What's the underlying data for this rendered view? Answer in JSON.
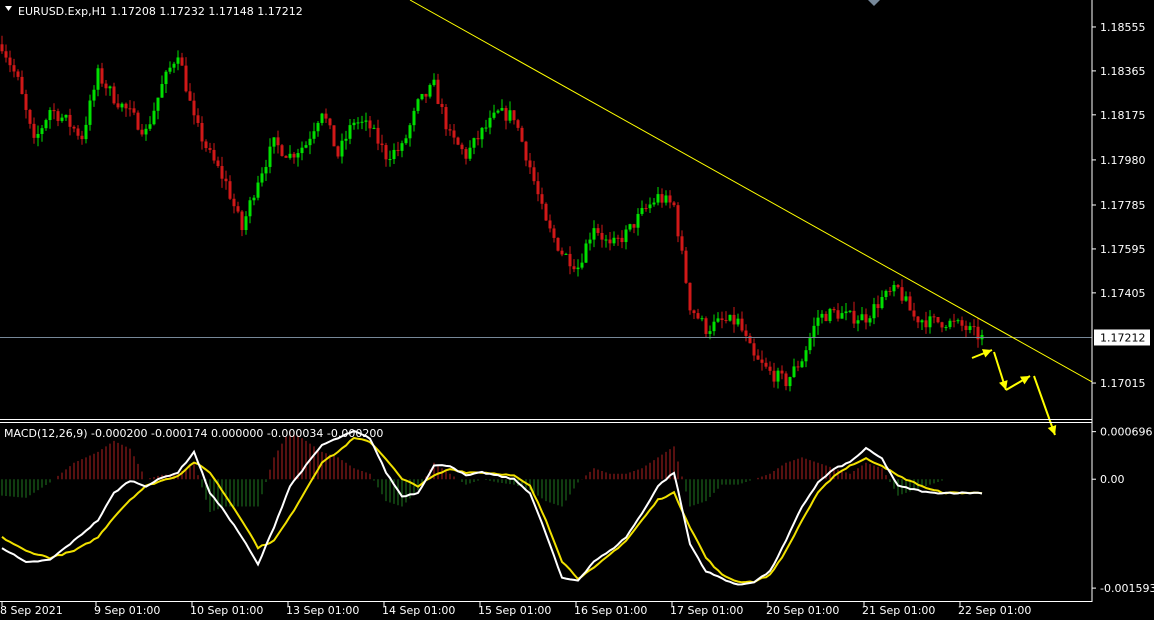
{
  "colors": {
    "background": "#000000",
    "axis": "#ffffff",
    "bull_candle": "#00e000",
    "bear_candle": "#d01818",
    "trendline": "#ffff00",
    "price_line": "#778899",
    "histogram_positive": "#b02020",
    "histogram_negative": "#1f7a1f",
    "macd_line": "#ffffff",
    "signal_line": "#f0e000",
    "arrows": "#ffff00"
  },
  "header": {
    "triangle_icon": "dropdown-triangle-icon",
    "symbol_text": "EURUSD.Exp,H1  1.17208 1.17232 1.17148 1.17212"
  },
  "macd_header": {
    "text": "MACD(12,26,9) -0.000200 -0.000174 0.000000 -0.000034 -0.000200"
  },
  "chart_data": [
    {
      "type": "candlestick",
      "title": "EURUSD.Exp,H1",
      "ylim": [
        1.1692,
        1.1865
      ],
      "y_ticks": [
        "1.18555",
        "1.18365",
        "1.18175",
        "1.17980",
        "1.17785",
        "1.17595",
        "1.17405",
        "1.17015"
      ],
      "current_price": "1.17212",
      "x_ticks": [
        "8 Sep 2021",
        "9 Sep 01:00",
        "10 Sep 01:00",
        "13 Sep 01:00",
        "14 Sep 01:00",
        "15 Sep 01:00",
        "16 Sep 01:00",
        "17 Sep 01:00",
        "20 Sep 01:00",
        "21 Sep 01:00",
        "22 Sep 01:00"
      ],
      "price_path_keypoints": [
        [
          0,
          1.1848
        ],
        [
          4,
          1.1832
        ],
        [
          8,
          1.1805
        ],
        [
          12,
          1.182
        ],
        [
          16,
          1.1815
        ],
        [
          20,
          1.1808
        ],
        [
          24,
          1.1835
        ],
        [
          28,
          1.1825
        ],
        [
          32,
          1.1818
        ],
        [
          36,
          1.181
        ],
        [
          40,
          1.183
        ],
        [
          44,
          1.1845
        ],
        [
          48,
          1.1815
        ],
        [
          52,
          1.18
        ],
        [
          56,
          1.1788
        ],
        [
          60,
          1.1768
        ],
        [
          64,
          1.179
        ],
        [
          68,
          1.1805
        ],
        [
          72,
          1.18
        ],
        [
          76,
          1.1805
        ],
        [
          80,
          1.182
        ],
        [
          84,
          1.18
        ],
        [
          88,
          1.1815
        ],
        [
          92,
          1.1812
        ],
        [
          96,
          1.18
        ],
        [
          100,
          1.1803
        ],
        [
          104,
          1.1822
        ],
        [
          108,
          1.183
        ],
        [
          112,
          1.1808
        ],
        [
          116,
          1.18
        ],
        [
          120,
          1.181
        ],
        [
          124,
          1.1818
        ],
        [
          128,
          1.1817
        ],
        [
          132,
          1.1795
        ],
        [
          136,
          1.177
        ],
        [
          140,
          1.1758
        ],
        [
          144,
          1.1752
        ],
        [
          148,
          1.177
        ],
        [
          152,
          1.176
        ],
        [
          156,
          1.1766
        ],
        [
          160,
          1.1775
        ],
        [
          164,
          1.1782
        ],
        [
          168,
          1.1778
        ],
        [
          172,
          1.1735
        ],
        [
          176,
          1.1725
        ],
        [
          180,
          1.1728
        ],
        [
          184,
          1.1728
        ],
        [
          188,
          1.1712
        ],
        [
          192,
          1.1706
        ],
        [
          196,
          1.1702
        ],
        [
          200,
          1.1712
        ],
        [
          204,
          1.173
        ],
        [
          208,
          1.1732
        ],
        [
          212,
          1.173
        ],
        [
          216,
          1.173
        ],
        [
          220,
          1.1738
        ],
        [
          224,
          1.1742
        ],
        [
          228,
          1.173
        ],
        [
          232,
          1.1728
        ],
        [
          236,
          1.1728
        ],
        [
          240,
          1.1726
        ],
        [
          245,
          1.1721
        ]
      ],
      "annotations": [
        "descending trendline",
        "yellow projection arrows pointing down"
      ]
    },
    {
      "type": "line",
      "title": "MACD(12,26,9)",
      "ylim": [
        -0.00165,
        0.00072
      ],
      "y_ticks": [
        "0.000696",
        "0.00",
        "-0.001593"
      ],
      "series": [
        {
          "name": "MACD",
          "keypoints": [
            [
              0,
              -0.001
            ],
            [
              6,
              -0.00122
            ],
            [
              12,
              -0.00118
            ],
            [
              18,
              -0.0009
            ],
            [
              24,
              -0.0006
            ],
            [
              28,
              -0.0002
            ],
            [
              32,
              -2e-05
            ],
            [
              36,
              -0.0001
            ],
            [
              40,
              2e-05
            ],
            [
              44,
              0.0001
            ],
            [
              48,
              0.0004
            ],
            [
              52,
              -0.0002
            ],
            [
              56,
              -0.0005
            ],
            [
              60,
              -0.00085
            ],
            [
              64,
              -0.00125
            ],
            [
              68,
              -0.0007
            ],
            [
              72,
              -0.0001
            ],
            [
              76,
              0.0002
            ],
            [
              80,
              0.0005
            ],
            [
              84,
              0.0006
            ],
            [
              88,
              0.0007
            ],
            [
              92,
              0.0006
            ],
            [
              96,
              0.0001
            ],
            [
              100,
              -0.00025
            ],
            [
              104,
              -0.0002
            ],
            [
              108,
              0.0002
            ],
            [
              112,
              0.0002
            ],
            [
              116,
              5e-05
            ],
            [
              120,
              0.0001
            ],
            [
              124,
              5e-05
            ],
            [
              128,
              0.0
            ],
            [
              132,
              -0.0002
            ],
            [
              136,
              -0.0008
            ],
            [
              140,
              -0.00145
            ],
            [
              144,
              -0.00148
            ],
            [
              148,
              -0.0012
            ],
            [
              152,
              -0.00105
            ],
            [
              156,
              -0.00085
            ],
            [
              160,
              -0.0005
            ],
            [
              164,
              -0.0001
            ],
            [
              168,
              0.0001
            ],
            [
              172,
              -0.00095
            ],
            [
              176,
              -0.00135
            ],
            [
              180,
              -0.00145
            ],
            [
              184,
              -0.00155
            ],
            [
              188,
              -0.0015
            ],
            [
              192,
              -0.00135
            ],
            [
              196,
              -0.0009
            ],
            [
              200,
              -0.0004
            ],
            [
              204,
              -5e-05
            ],
            [
              208,
              0.00015
            ],
            [
              212,
              0.00025
            ],
            [
              216,
              0.00045
            ],
            [
              220,
              0.0003
            ],
            [
              224,
              -0.0001
            ],
            [
              228,
              -0.00015
            ],
            [
              232,
              -0.0002
            ],
            [
              236,
              -0.0002
            ],
            [
              240,
              -0.0002
            ],
            [
              245,
              -0.0002
            ]
          ]
        },
        {
          "name": "Signal",
          "keypoints": [
            [
              0,
              -0.00085
            ],
            [
              6,
              -0.00105
            ],
            [
              12,
              -0.00115
            ],
            [
              18,
              -0.00105
            ],
            [
              24,
              -0.00085
            ],
            [
              28,
              -0.00055
            ],
            [
              32,
              -0.0003
            ],
            [
              36,
              -0.0001
            ],
            [
              40,
              -2e-05
            ],
            [
              44,
              5e-05
            ],
            [
              48,
              0.00025
            ],
            [
              52,
              0.0001
            ],
            [
              56,
              -0.00025
            ],
            [
              60,
              -0.0006
            ],
            [
              64,
              -0.001
            ],
            [
              68,
              -0.0009
            ],
            [
              72,
              -0.00055
            ],
            [
              76,
              -0.00015
            ],
            [
              80,
              0.00025
            ],
            [
              84,
              0.0004
            ],
            [
              88,
              0.0006
            ],
            [
              92,
              0.00055
            ],
            [
              96,
              0.0003
            ],
            [
              100,
              0.0
            ],
            [
              104,
              -0.0001
            ],
            [
              108,
              5e-05
            ],
            [
              112,
              0.00015
            ],
            [
              116,
              0.0001
            ],
            [
              120,
              0.0001
            ],
            [
              124,
              8e-05
            ],
            [
              128,
              5e-05
            ],
            [
              132,
              -0.0001
            ],
            [
              136,
              -0.0006
            ],
            [
              140,
              -0.0012
            ],
            [
              144,
              -0.00145
            ],
            [
              148,
              -0.0013
            ],
            [
              152,
              -0.0011
            ],
            [
              156,
              -0.0009
            ],
            [
              160,
              -0.0006
            ],
            [
              164,
              -0.0003
            ],
            [
              168,
              -0.0002
            ],
            [
              172,
              -0.0007
            ],
            [
              176,
              -0.00115
            ],
            [
              180,
              -0.0014
            ],
            [
              184,
              -0.0015
            ],
            [
              188,
              -0.0015
            ],
            [
              192,
              -0.0014
            ],
            [
              196,
              -0.00105
            ],
            [
              200,
              -0.0006
            ],
            [
              204,
              -0.0002
            ],
            [
              208,
              5e-05
            ],
            [
              212,
              0.0002
            ],
            [
              216,
              0.0003
            ],
            [
              220,
              0.0002
            ],
            [
              224,
              5e-05
            ],
            [
              228,
              -5e-05
            ],
            [
              232,
              -0.00015
            ],
            [
              236,
              -0.0002
            ],
            [
              240,
              -0.0002
            ],
            [
              245,
              -0.0002
            ]
          ]
        }
      ]
    }
  ]
}
